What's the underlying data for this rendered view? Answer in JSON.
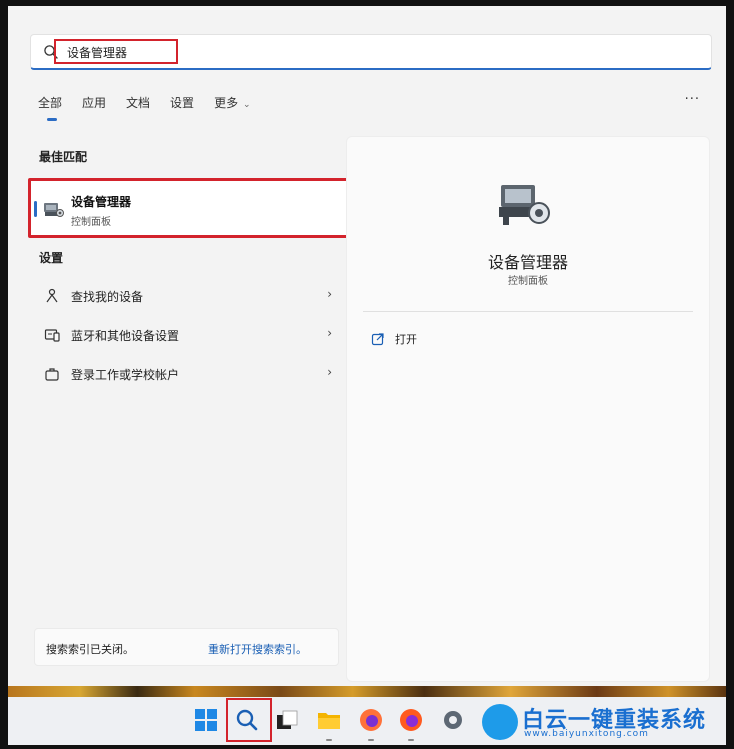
{
  "search": {
    "value": "设备管理器",
    "placeholder": ""
  },
  "tabs": [
    {
      "label": "全部",
      "active": true
    },
    {
      "label": "应用"
    },
    {
      "label": "文档"
    },
    {
      "label": "设置"
    },
    {
      "label": "更多"
    }
  ],
  "more_options": "···",
  "best_match": {
    "section_title": "最佳匹配",
    "title": "设备管理器",
    "subtitle": "控制面板"
  },
  "settings": {
    "section_title": "设置",
    "items": [
      {
        "label": "查找我的设备",
        "icon": "person-location-icon"
      },
      {
        "label": "蓝牙和其他设备设置",
        "icon": "devices-icon"
      },
      {
        "label": "登录工作或学校帐户",
        "icon": "briefcase-icon"
      }
    ]
  },
  "index_bar": {
    "message": "搜索索引已关闭。",
    "link": "重新打开搜索索引。"
  },
  "preview": {
    "title": "设备管理器",
    "subtitle": "控制面板",
    "actions": [
      {
        "label": "打开",
        "icon": "open-external-icon"
      }
    ]
  },
  "brand": {
    "text": "白云一键重装系统",
    "url": "www.baiyunxitong.com"
  },
  "colors": {
    "accent": "#2b6cc4",
    "highlight": "#d3232c",
    "brand": "#1a6fd0"
  }
}
